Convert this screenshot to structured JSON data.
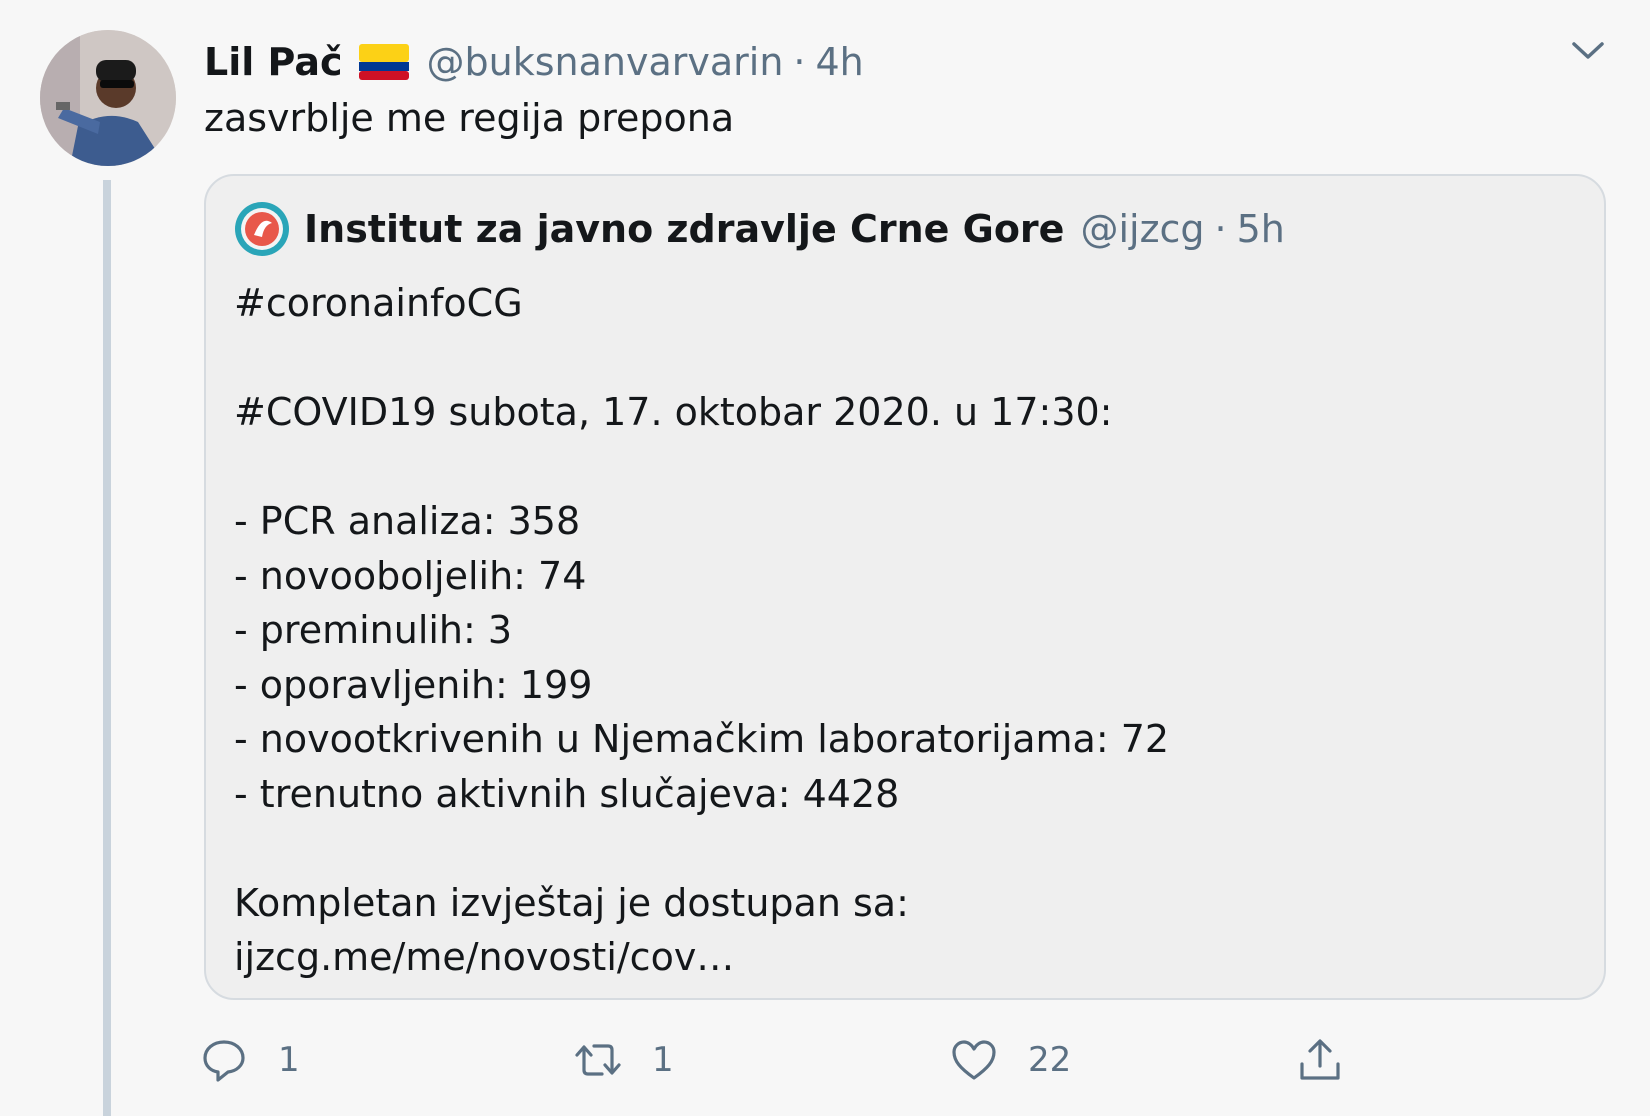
{
  "tweet": {
    "author_name": "Lil Pač",
    "flag_icon": "colombia-flag-icon",
    "handle": "@buksnanvarvarin",
    "separator": "·",
    "time": "4h",
    "text": "zasvrblje me regija prepona"
  },
  "quoted": {
    "author_name": "Institut za javno zdravlje Crne Gore",
    "handle": "@ijzcg",
    "separator": "·",
    "time": "5h",
    "lines": [
      "#coronainfoCG",
      "",
      "#COVID19 subota, 17. oktobar 2020. u 17:30:",
      "",
      "- PCR analiza: 358",
      "- novooboljelih: 74",
      "- preminulih: 3",
      "- oporavljenih: 199",
      "- novootkrivenih u Njemačkim laboratorijama: 72",
      "- trenutno aktivnih slučajeva: 4428",
      "",
      "Kompletan izvještaj je dostupan sa:",
      "ijzcg.me/me/novosti/cov…"
    ]
  },
  "actions": {
    "reply": {
      "icon": "reply-icon",
      "count": "1"
    },
    "retweet": {
      "icon": "retweet-icon",
      "count": "1"
    },
    "like": {
      "icon": "heart-icon",
      "count": "22"
    },
    "share": {
      "icon": "share-icon"
    }
  },
  "colors": {
    "text": "#14171a",
    "secondary": "#5b7083",
    "quote_bg": "#efefef"
  }
}
